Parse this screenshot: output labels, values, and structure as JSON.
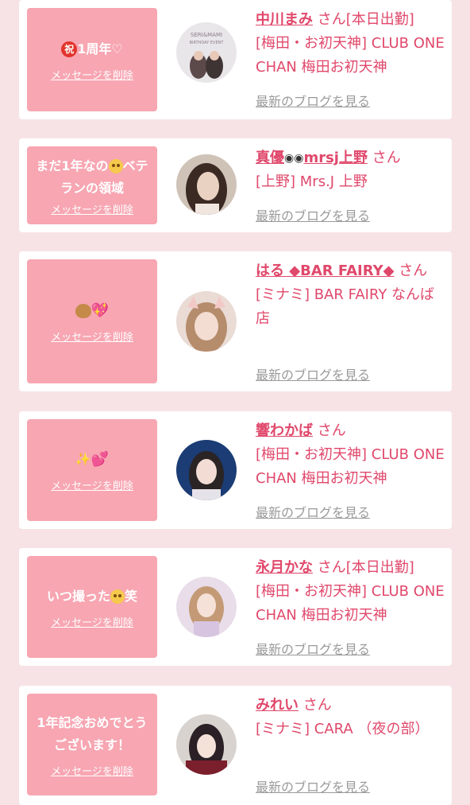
{
  "delete_label": "メッセージを削除",
  "san": "さん",
  "blog_label": "最新のブログを見る",
  "cards": [
    {
      "message": "1周年♡",
      "name": "中川まみ",
      "suffix": "[本日出勤]",
      "shop": "[梅田・お初天神] CLUB ONE CHAN 梅田お初天神"
    },
    {
      "message_part1": "まだ1年なの",
      "message_part2": "ベテランの領域",
      "name_a": "真優",
      "name_b": "mrsj上野",
      "suffix": "",
      "shop": "[上野] Mrs.J 上野"
    },
    {
      "message": "",
      "name": "はる ◆BAR FAIRY◆",
      "suffix": "",
      "shop": "[ミナミ] BAR FAIRY なんば店"
    },
    {
      "message": "",
      "name": "響わかば",
      "suffix": "",
      "shop": "[梅田・お初天神] CLUB ONE CHAN 梅田お初天神"
    },
    {
      "message_part1": "いつ撮った",
      "message_part2": "笑",
      "name": "永月かな",
      "suffix": "[本日出勤]",
      "shop": "[梅田・お初天神] CLUB ONE CHAN 梅田お初天神"
    },
    {
      "message": "1年記念おめでとうございます！",
      "name": "みれい",
      "suffix": "",
      "shop": "[ミナミ] CARA （夜の部）"
    }
  ],
  "avatar_texts": {
    "card0_line1": "SERI&MAMI",
    "card0_line2": "BIRTHDAY EVENT"
  },
  "colors": {
    "page_bg": "#f7e3e5",
    "message_bg": "#f7a6b2",
    "accent": "#e0486b",
    "muted": "#9a9a9a"
  },
  "icons": [
    "iwai-badge-icon",
    "flushed-face-icon",
    "eyes-icon",
    "teddy-bear-icon",
    "sparkling-heart-icon",
    "sparkles-icon",
    "two-hearts-icon",
    "rolling-eyes-face-icon"
  ]
}
